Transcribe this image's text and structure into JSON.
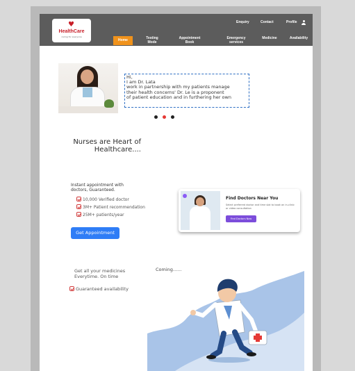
{
  "brand": {
    "name": "HealthCare",
    "tagline": "caring for everyone",
    "accent": "#f0921b",
    "nav_bg": "#5c5c5c"
  },
  "nav": {
    "top_links": [
      "Enquiry",
      "Contact",
      "Profile"
    ],
    "items": [
      {
        "label": "Home",
        "active": true
      },
      {
        "label": "Testing Mode"
      },
      {
        "label": "Appointment Book"
      },
      {
        "label": "Emergency services"
      },
      {
        "label": "Medicine"
      },
      {
        "label": "Availability"
      }
    ],
    "profile_icon": "user-icon"
  },
  "slider": {
    "quote_lines": [
      "Hi,",
      "I am Dr. Lata",
      "work in partnership with my patients manage",
      "their health concerns' Dr. Le is a proponent",
      "of patient education and in furthering her own"
    ],
    "active_dot": 1,
    "dot_count": 3,
    "dot_active_color": "#e53935"
  },
  "hero": {
    "headline_line1": "Nurses are Heart of",
    "headline_line2": "Healthcare...."
  },
  "appointment": {
    "intro_line1": "Instant appointment with",
    "intro_line2": "doctors, Guaranteed.",
    "features": [
      "10,000 Verified doctor",
      "3M+ Patient recommendation",
      "25M+ patients/year"
    ],
    "button": "Get Appointment"
  },
  "find_card": {
    "title": "Find Doctors Near You",
    "description": "Select preferred doctor and time slot to book an in-clinic or video consultation",
    "button": "Find Doctors Now"
  },
  "medicines": {
    "line1": "Get all your medicines",
    "line2": "Everytime. On time",
    "guarantee": "Guaranteed availability",
    "coming": "Coming......"
  }
}
